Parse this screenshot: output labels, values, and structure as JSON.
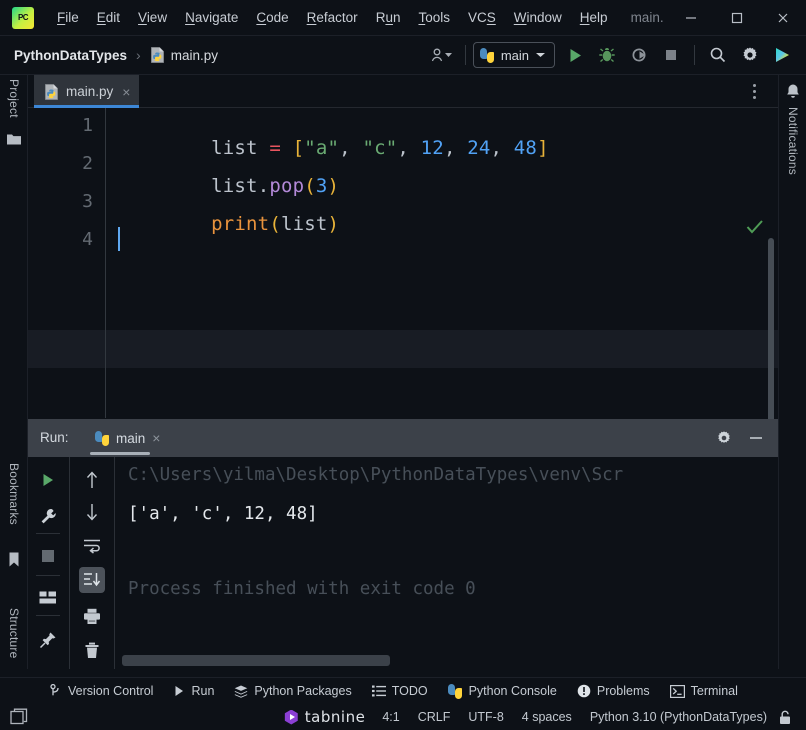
{
  "window": {
    "title": "main.",
    "app_icon": "pycharm-logo-icon",
    "minimize": "minimize-icon",
    "maximize": "maximize-icon",
    "close": "close-icon"
  },
  "menu": {
    "items": [
      {
        "label": "File",
        "mnemonic": "F"
      },
      {
        "label": "Edit",
        "mnemonic": "E"
      },
      {
        "label": "View",
        "mnemonic": "V"
      },
      {
        "label": "Navigate",
        "mnemonic": "N"
      },
      {
        "label": "Code",
        "mnemonic": "C"
      },
      {
        "label": "Refactor",
        "mnemonic": "R"
      },
      {
        "label": "Run",
        "mnemonic": "u"
      },
      {
        "label": "Tools",
        "mnemonic": "T"
      },
      {
        "label": "VCS",
        "mnemonic": "S"
      },
      {
        "label": "Window",
        "mnemonic": "W"
      },
      {
        "label": "Help",
        "mnemonic": "H"
      }
    ]
  },
  "toolbar": {
    "breadcrumb": {
      "project": "PythonDataTypes",
      "separator": "›",
      "file": "main.py",
      "file_icon": "python-file-icon"
    },
    "user_icon": "user-avatar-icon",
    "run_config": {
      "name": "main",
      "icon": "python-icon",
      "chevron": "chevron-down-icon"
    },
    "actions": [
      {
        "name": "run-button",
        "icon": "play-icon",
        "color": "#59a869"
      },
      {
        "name": "debug-button",
        "icon": "bug-icon",
        "color": "#57965c"
      },
      {
        "name": "run-with-coverage-button",
        "icon": "coverage-icon",
        "color": "#9aa0a8"
      },
      {
        "name": "stop-button",
        "icon": "stop-square-icon",
        "color": "#8b9198"
      },
      {
        "name": "search-everywhere-button",
        "icon": "search-icon",
        "color": "#c5cbd2"
      },
      {
        "name": "settings-button",
        "icon": "gear-icon",
        "color": "#c5cbd2"
      },
      {
        "name": "ide-assistant-button",
        "icon": "colored-arrow-icon",
        "color": "#3dd6c8"
      }
    ]
  },
  "editor_tabs": {
    "tabs": [
      {
        "label": "main.py",
        "icon": "python-file-icon",
        "close": "×",
        "active": true
      }
    ],
    "overflow_menu": "more-options-icon"
  },
  "left_stripe": {
    "items": [
      {
        "label": "Project",
        "icon": "folder-icon"
      },
      {
        "label": "Bookmarks",
        "icon": "bookmark-icon"
      },
      {
        "label": "Structure",
        "icon": "structure-icon"
      }
    ]
  },
  "right_stripe": {
    "items": [
      {
        "label": "Notifications",
        "icon": "bell-icon"
      }
    ]
  },
  "editor": {
    "line_numbers": [
      "1",
      "2",
      "3",
      "4"
    ],
    "inspection_status": "ok-checkmark-icon",
    "lines": [
      {
        "number": "1",
        "tokens": [
          {
            "text": "list",
            "cls": "t-def"
          },
          {
            "text": " ",
            "cls": "t-def"
          },
          {
            "text": "=",
            "cls": "t-op"
          },
          {
            "text": " ",
            "cls": "t-def"
          },
          {
            "text": "[",
            "cls": "t-brk"
          },
          {
            "text": "\"a\"",
            "cls": "t-str"
          },
          {
            "text": ", ",
            "cls": "t-def"
          },
          {
            "text": "\"c\"",
            "cls": "t-str"
          },
          {
            "text": ", ",
            "cls": "t-def"
          },
          {
            "text": "12",
            "cls": "t-num"
          },
          {
            "text": ", ",
            "cls": "t-def"
          },
          {
            "text": "24",
            "cls": "t-num"
          },
          {
            "text": ", ",
            "cls": "t-def"
          },
          {
            "text": "48",
            "cls": "t-num"
          },
          {
            "text": "]",
            "cls": "t-brk"
          }
        ]
      },
      {
        "number": "2",
        "tokens": [
          {
            "text": "list",
            "cls": "t-def"
          },
          {
            "text": ".",
            "cls": "t-def"
          },
          {
            "text": "pop",
            "cls": "t-fn"
          },
          {
            "text": "(",
            "cls": "t-par"
          },
          {
            "text": "3",
            "cls": "t-num"
          },
          {
            "text": ")",
            "cls": "t-par"
          }
        ]
      },
      {
        "number": "3",
        "tokens": [
          {
            "text": "print",
            "cls": "t-kw"
          },
          {
            "text": "(",
            "cls": "t-par"
          },
          {
            "text": "list",
            "cls": "t-def"
          },
          {
            "text": ")",
            "cls": "t-par"
          }
        ]
      },
      {
        "number": "4",
        "tokens": []
      }
    ],
    "caret_line": 4
  },
  "run_panel": {
    "label": "Run:",
    "tab": {
      "label": "main",
      "icon": "python-icon",
      "close": "×"
    },
    "header_actions": [
      {
        "name": "run-settings-button",
        "icon": "gear-icon"
      },
      {
        "name": "hide-panel-button",
        "icon": "minimize-icon"
      }
    ],
    "left_toolbar": [
      {
        "name": "rerun-button",
        "icon": "play-icon"
      },
      {
        "name": "modify-options-button",
        "icon": "wrench-icon"
      },
      {
        "name": "stop-button",
        "icon": "stop-square-icon"
      },
      {
        "name": "layout-settings-button",
        "icon": "layout-icon"
      },
      {
        "name": "pin-tab-button",
        "icon": "pin-icon"
      }
    ],
    "right_toolbar": [
      {
        "name": "up-the-stack-trace-button",
        "icon": "arrow-up-icon"
      },
      {
        "name": "down-the-stack-trace-button",
        "icon": "arrow-down-icon"
      },
      {
        "name": "soft-wrap-button",
        "icon": "soft-wrap-icon"
      },
      {
        "name": "scroll-to-end-button",
        "icon": "scroll-to-end-icon",
        "selected": true
      },
      {
        "name": "print-button",
        "icon": "printer-icon"
      },
      {
        "name": "clear-all-button",
        "icon": "trash-icon"
      }
    ],
    "console": {
      "lines": [
        {
          "text": "C:\\Users\\yilma\\Desktop\\PythonDataTypes\\venv\\Scr",
          "style": "cdim"
        },
        {
          "text": "['a', 'c', 12, 48]",
          "style": "cout"
        },
        {
          "text": "",
          "style": "cdim"
        },
        {
          "text": "Process finished with exit code 0",
          "style": "cdim"
        }
      ]
    }
  },
  "tool_window_bar": {
    "items": [
      {
        "label": "Version Control",
        "icon": "branch-icon"
      },
      {
        "label": "Run",
        "icon": "play-icon"
      },
      {
        "label": "Python Packages",
        "icon": "layers-icon"
      },
      {
        "label": "TODO",
        "icon": "list-icon"
      },
      {
        "label": "Python Console",
        "icon": "python-icon"
      },
      {
        "label": "Problems",
        "icon": "warning-circle-icon"
      },
      {
        "label": "Terminal",
        "icon": "terminal-icon"
      }
    ]
  },
  "status_bar": {
    "left_icon": "toggle-toolwindows-icon",
    "plugin": {
      "name": "tabnine",
      "icon": "tabnine-hex-icon"
    },
    "caret_position": "4:1",
    "line_separator": "CRLF",
    "encoding": "UTF-8",
    "indent": "4 spaces",
    "interpreter": "Python 3.10 (PythonDataTypes)",
    "lock_icon": "unlocked-padlock-icon"
  }
}
